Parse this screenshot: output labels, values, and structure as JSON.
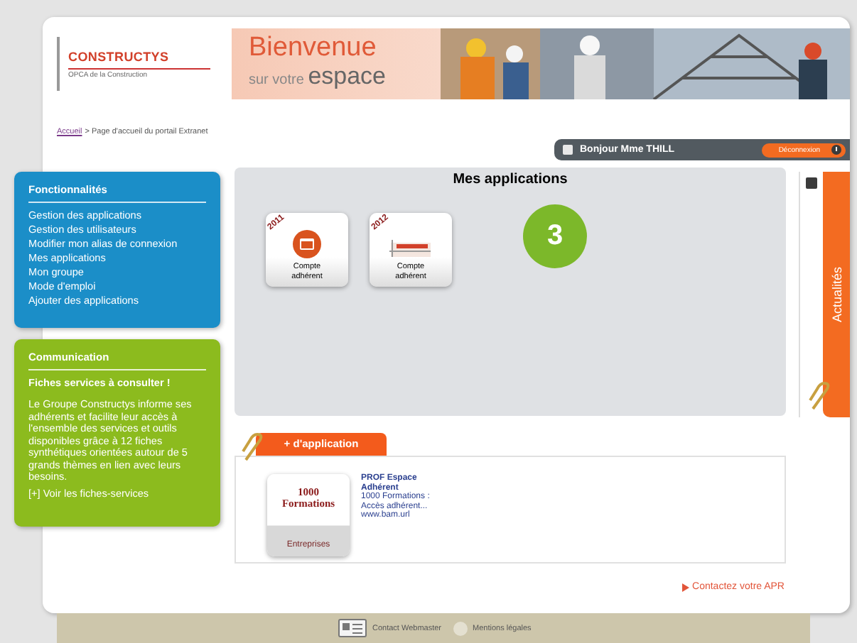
{
  "header": {
    "logo": {
      "name": "CONSTRUCTYS",
      "tagline": "OPCA de la Construction"
    },
    "banner": {
      "title": "Bienvenue",
      "subtitle_prefix": "sur votre",
      "subtitle_word": "espace"
    }
  },
  "breadcrumb": [
    {
      "label": "Accueil",
      "kind": "link"
    },
    {
      "label": "> Page d'accueil du portail Extranet",
      "kind": "text"
    }
  ],
  "user_bar": {
    "greeting": "Bonjour Mme THILL",
    "logout": "Déconnexion"
  },
  "sidebar": [
    {
      "kind": "menu",
      "color": "#1b8ec8",
      "title": "Fonctionnalités",
      "items": [
        "Gestion des applications",
        "Gestion des utilisateurs",
        "Modifier mon alias de connexion",
        "Mes applications",
        "Mon groupe",
        "Mode d'emploi",
        "Ajouter des applications"
      ]
    },
    {
      "kind": "news",
      "color": "#8cbb1e",
      "title": "Communication",
      "subtitle": "Fiches services à consulter !",
      "text": "Le Groupe Constructys informe ses adhérents et facilite leur accès à l'ensemble des services et outils disponibles grâce à 12 fiches synthétiques orientées autour de 5 grands thèmes en lien avec leurs besoins.",
      "link": "[+] Voir les fiches-services"
    }
  ],
  "applications": {
    "title": "Mes applications",
    "tiles": [
      {
        "kind": "circle",
        "year": "2011",
        "label": "Compte adhérent"
      },
      {
        "kind": "logo",
        "year": "2012",
        "label": "Compte adhérent"
      }
    ]
  },
  "badge": "3",
  "news_tab": {
    "label": "Actualités"
  },
  "add_tab": "+ d'application",
  "catalog": [
    {
      "logo_lines": [
        "1000",
        "Formations"
      ],
      "logo_caption": "Entreprises",
      "title": "PROF Espace Adhérent",
      "description": [
        "1000 Formations :",
        "Accès adhérent...",
        "www.bam.url"
      ]
    }
  ],
  "contact_link": "Contactez votre APR",
  "footer": [
    {
      "kind": "card",
      "label": "Contact Webmaster"
    },
    {
      "kind": "circle",
      "label": "Mentions légales"
    }
  ]
}
